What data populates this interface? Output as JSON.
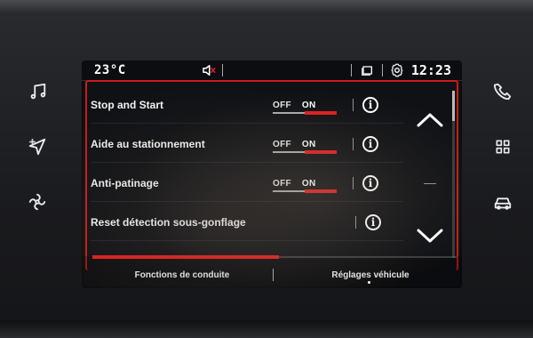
{
  "status": {
    "temperature": "23°C",
    "time": "12:23"
  },
  "settings": {
    "rows": [
      {
        "label": "Stop and Start",
        "off_label": "OFF",
        "on_label": "ON"
      },
      {
        "label": "Aide au stationnement",
        "off_label": "OFF",
        "on_label": "ON"
      },
      {
        "label": "Anti-patinage",
        "off_label": "OFF",
        "on_label": "ON"
      },
      {
        "label": "Reset détection sous-gonflage"
      }
    ],
    "info_glyph": "i"
  },
  "tabs": {
    "left": "Fonctions de conduite",
    "right": "Réglages véhicule"
  },
  "icons": {
    "left_keys": [
      "music-icon",
      "navigation-icon",
      "ac-fan-icon"
    ],
    "right_keys": [
      "phone-icon",
      "apps-grid-icon",
      "vehicle-icon"
    ],
    "status": [
      "mute-icon",
      "screens-icon",
      "settings-gear-icon"
    ]
  },
  "colors": {
    "accent_red": "#e01d1d",
    "text": "#ffffff",
    "screen_bg": "#0f1115"
  }
}
